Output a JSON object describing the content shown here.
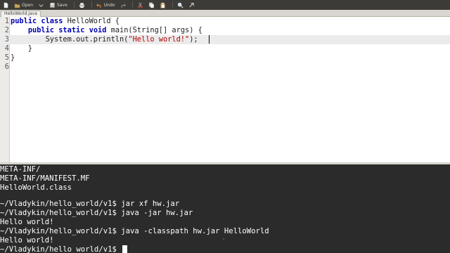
{
  "toolbar": {
    "open_label": "Open",
    "save_label": "Save",
    "undo_label": "Undo"
  },
  "tab": {
    "title": "HelloWorld.java"
  },
  "editor": {
    "lines": [
      {
        "number": "1",
        "text": "public class HelloWorld {"
      },
      {
        "number": "2",
        "text": "    public static void main(String[] args) {"
      },
      {
        "number": "3",
        "text": "        System.out.println(\"Hello world!\");"
      },
      {
        "number": "4",
        "text": "    }"
      },
      {
        "number": "5",
        "text": "}"
      },
      {
        "number": "6",
        "text": ""
      }
    ]
  },
  "terminal": {
    "lines": [
      "META-INF/",
      "META-INF/MANIFEST.MF",
      "HelloWorld.class",
      "~/Vladykin/hello_world/v1$ jar xf hw.jar",
      "~/Vladykin/hello_world/v1$ java -jar hw.jar",
      "Hello world!",
      "~/Vladykin/hello_world/v1$ java -classpath hw.jar HelloWorld",
      "Hello world!",
      "~/Vladykin/hello_world/v1$ "
    ]
  },
  "colors": {
    "keyword": "#0000b3",
    "string": "#b40000",
    "terminal_bg": "#2b2b2b",
    "toolbar_bg": "#3c3b37"
  }
}
